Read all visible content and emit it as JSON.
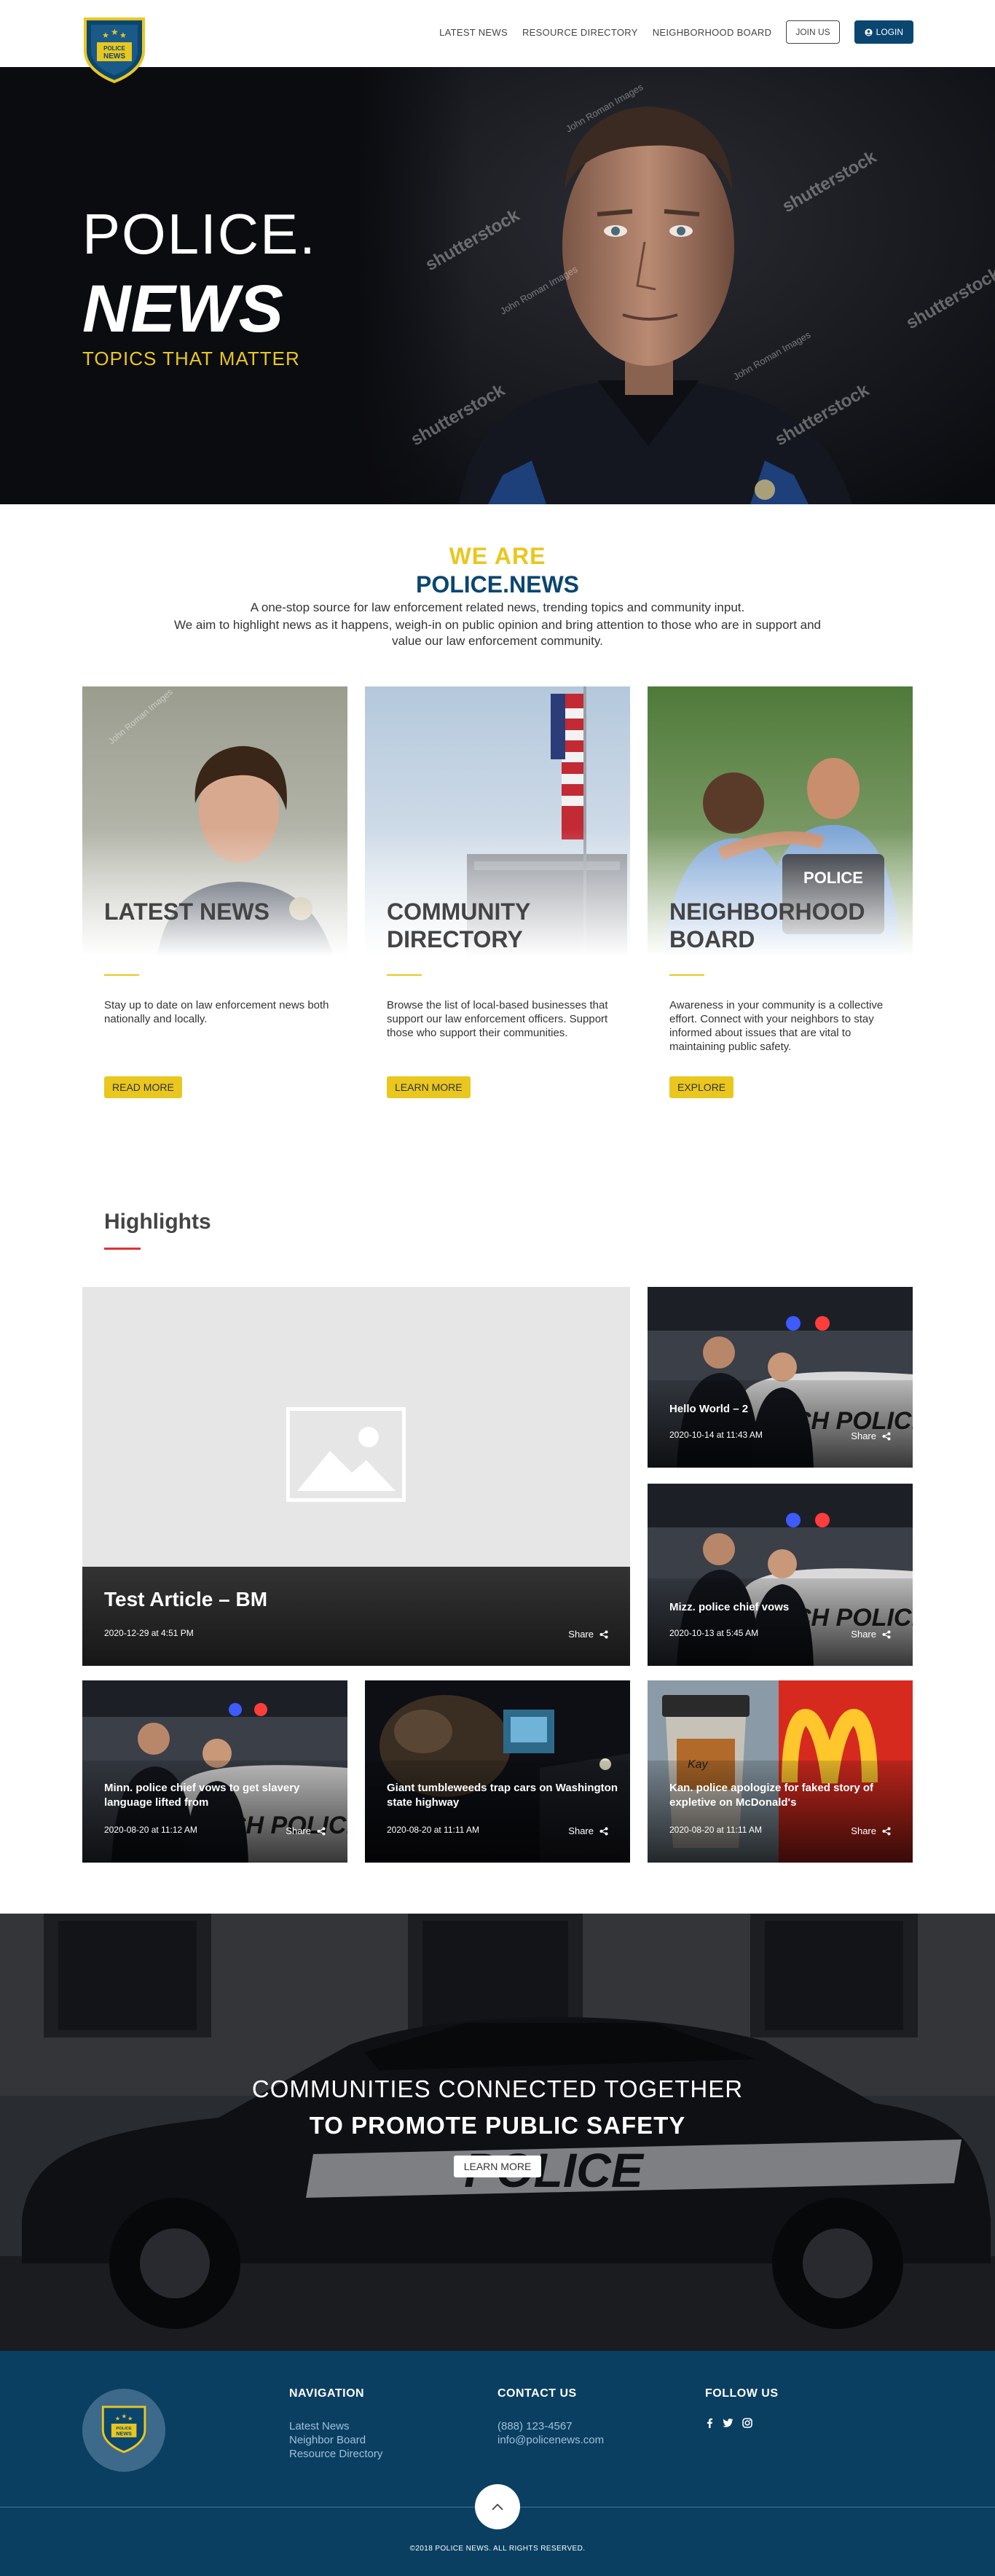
{
  "header": {
    "logo_text": "POLICE NEWS",
    "nav": [
      "LATEST NEWS",
      "RESOURCE DIRECTORY",
      "NEIGHBORHOOD BOARD"
    ],
    "join_label": "JOIN US",
    "login_label": "LOGIN"
  },
  "hero": {
    "line1": "POLICE.",
    "line2": "NEWS",
    "tagline": "TOPICS THAT MATTER"
  },
  "about": {
    "we_are": "WE ARE",
    "brand": "POLICE.NEWS",
    "line1": "A one-stop source for law enforcement related news, trending topics and community input.",
    "line2": "We aim to highlight news as it happens, weigh-in on public opinion and bring attention to those who are in support and value our law enforcement community."
  },
  "cards": [
    {
      "title": "LATEST NEWS",
      "desc": "Stay up to date on law enforcement news both nationally and locally.",
      "button": "READ MORE"
    },
    {
      "title": "COMMUNITY DIRECTORY",
      "desc": "Browse the list of local-based businesses that support our law enforcement officers. Support those who support their communities.",
      "button": "LEARN MORE"
    },
    {
      "title": "NEIGHBORHOOD BOARD",
      "desc": "Awareness in your community is a collective effort. Connect with your neighbors to stay informed about issues that are vital to maintaining public safety.",
      "button": "EXPLORE"
    }
  ],
  "highlights": {
    "title": "Highlights",
    "share_label": "Share",
    "featured": {
      "title": "Test Article – BM",
      "date": "2020-12-29 at 4:51 PM"
    },
    "side": [
      {
        "title": "Hello World – 2",
        "date": "2020-10-14 at 11:43 AM"
      },
      {
        "title": "Mizz. police chief vows",
        "date": "2020-10-13 at 5:45 AM"
      }
    ],
    "bottom": [
      {
        "title": "Minn. police chief vows to get slavery language lifted from",
        "date": "2020-08-20 at 11:12 AM"
      },
      {
        "title": "Giant tumbleweeds trap cars on Washington state highway",
        "date": "2020-08-20 at 11:11 AM"
      },
      {
        "title": "Kan. police apologize for faked story of expletive on McDonald's",
        "date": "2020-08-20 at 11:11 AM"
      }
    ]
  },
  "cta": {
    "line1": "COMMUNITIES CONNECTED TOGETHER",
    "line2": "TO PROMOTE PUBLIC SAFETY",
    "button": "LEARN MORE"
  },
  "footer": {
    "nav_head": "NAVIGATION",
    "nav_links": [
      "Latest News",
      "Neighbor Board",
      "Resource Directory"
    ],
    "contact_head": "CONTACT US",
    "phone": "(888) 123-4567",
    "email": "info@policenews.com",
    "follow_head": "FOLLOW US",
    "copyright": "©2018 POLICE NEWS. ALL RIGHTS RESERVED."
  },
  "colors": {
    "brand_blue": "#0a4670",
    "accent_yellow": "#e9c71f",
    "footer_bg": "#0a3f62"
  }
}
